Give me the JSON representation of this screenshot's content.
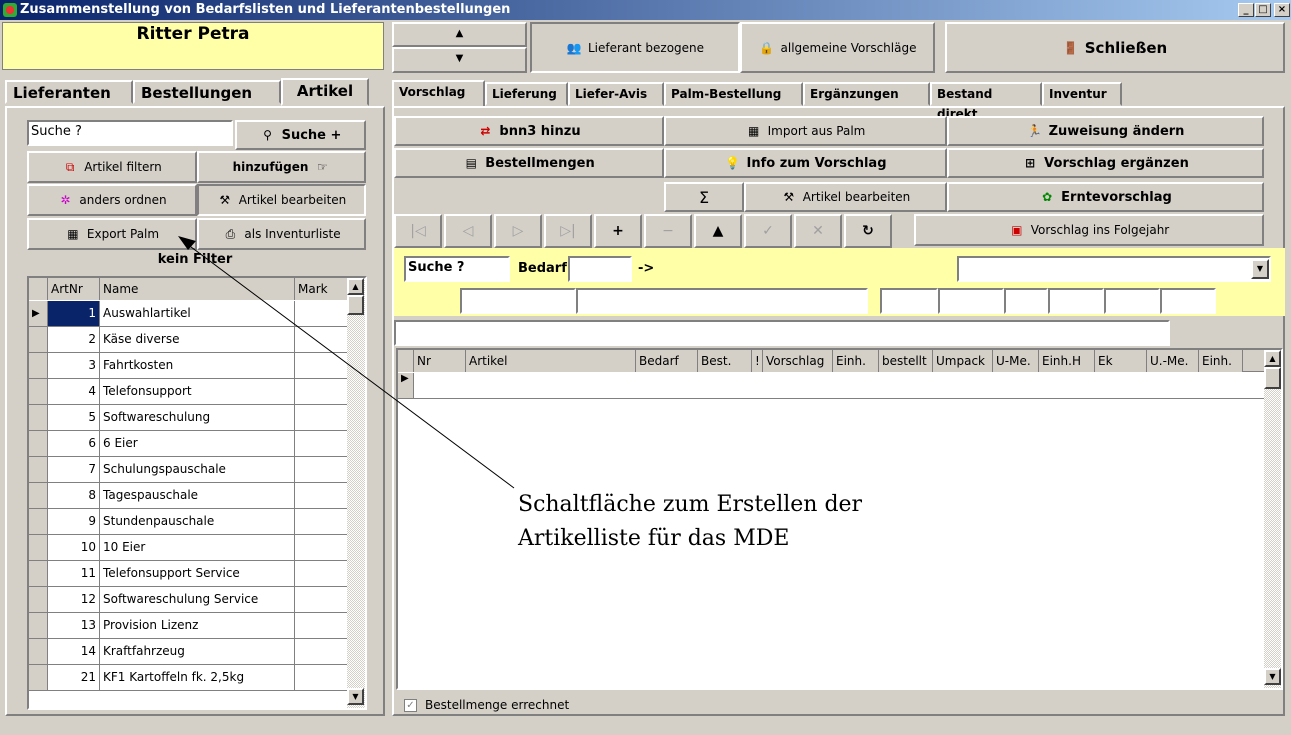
{
  "window": {
    "title": "Zusammenstellung von Bedarfslisten und Lieferantenbestellungen",
    "min": "_",
    "max": "□",
    "close": "×"
  },
  "user": {
    "name": "Ritter Petra"
  },
  "toolbar": {
    "lieferant": "Lieferant bezogene",
    "allgemein": "allgemeine Vorschläge",
    "close": "Schließen"
  },
  "left_tabs": [
    "Lieferanten",
    "Bestellungen",
    "Artikel"
  ],
  "left": {
    "search_value": "Suche ?",
    "search_btn": "Suche +",
    "filter_btn": "Artikel filtern",
    "add_btn": "hinzufügen",
    "order_btn": "anders ordnen",
    "edit_btn": "Artikel bearbeiten",
    "export_btn": "Export Palm",
    "inv_btn": "als Inventurliste",
    "filter_status": "kein Filter",
    "columns": [
      "ArtNr",
      "Name",
      "Mark"
    ],
    "rows": [
      {
        "nr": "1",
        "name": "Auswahlartikel"
      },
      {
        "nr": "2",
        "name": "Käse diverse"
      },
      {
        "nr": "3",
        "name": "Fahrtkosten"
      },
      {
        "nr": "4",
        "name": "Telefonsupport"
      },
      {
        "nr": "5",
        "name": "Softwareschulung"
      },
      {
        "nr": "6",
        "name": "6 Eier"
      },
      {
        "nr": "7",
        "name": "Schulungspauschale"
      },
      {
        "nr": "8",
        "name": "Tagespauschale"
      },
      {
        "nr": "9",
        "name": "Stundenpauschale"
      },
      {
        "nr": "10",
        "name": "10 Eier"
      },
      {
        "nr": "11",
        "name": "Telefonsupport Service"
      },
      {
        "nr": "12",
        "name": "Softwareschulung Service"
      },
      {
        "nr": "13",
        "name": "Provision Lizenz"
      },
      {
        "nr": "14",
        "name": "Kraftfahrzeug"
      },
      {
        "nr": "21",
        "name": "KF1 Kartoffeln fk. 2,5kg"
      }
    ]
  },
  "right_tabs": [
    "Vorschlag",
    "Lieferung",
    "Liefer-Avis",
    "Palm-Bestellung",
    "Ergänzungen",
    "Bestand direkt",
    "Inventur"
  ],
  "actions": {
    "bnn3": "bnn3 hinzu",
    "import": "Import aus Palm",
    "zuweisung": "Zuweisung ändern",
    "bestell": "Bestellmengen",
    "info": "Info zum Vorschlag",
    "ergaenzen": "Vorschlag ergänzen",
    "sigma": "Σ",
    "artedit": "Artikel bearbeiten",
    "ernte": "Erntevorschlag",
    "folgejahr": "Vorschlag ins Folgejahr"
  },
  "nav": [
    "|◁",
    "◁",
    "▷",
    "▷|",
    "+",
    "−",
    "▲",
    "✓",
    "✕",
    "↻"
  ],
  "filter": {
    "search": "Suche ?",
    "bedarf": "Bedarf",
    "arrow": "->"
  },
  "grid": {
    "columns": [
      "Nr",
      "Artikel",
      "Bedarf",
      "Best.",
      "!",
      "Vorschlag",
      "Einh.",
      "bestellt",
      "Umpack",
      "U-Me.",
      "Einh.H",
      "Ek",
      "U.-Me.",
      "Einh."
    ]
  },
  "checkbox": {
    "label": "Bestellmenge errechnet",
    "checked": true
  },
  "annotation": {
    "line1": "Schaltfläche zum Erstellen der",
    "line2": "Artikelliste für das MDE"
  }
}
